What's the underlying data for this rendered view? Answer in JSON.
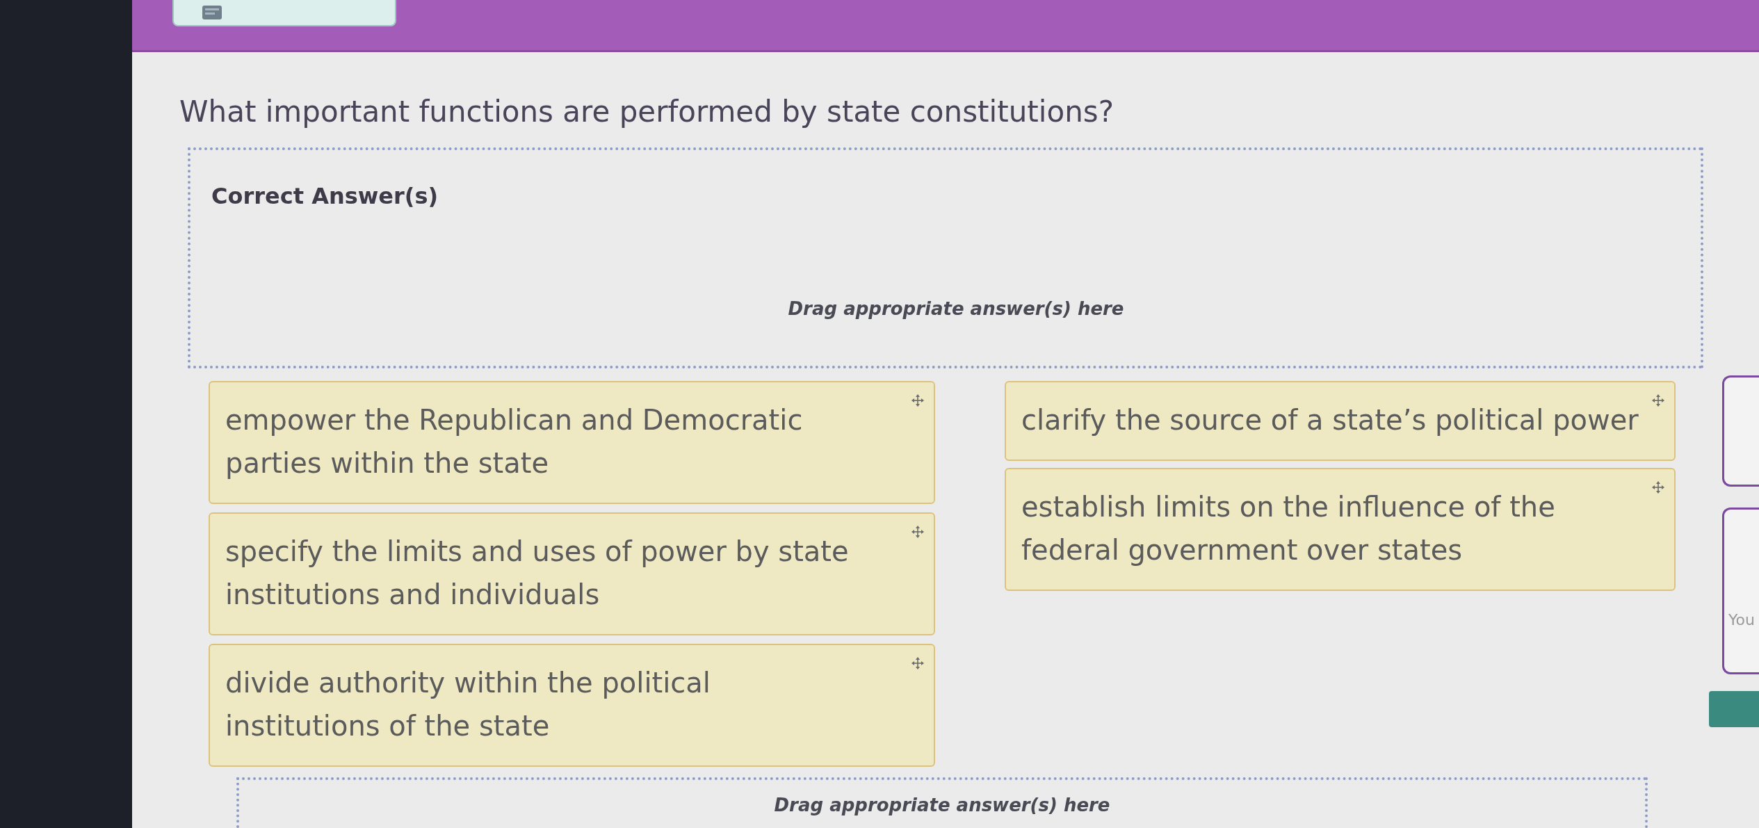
{
  "question": "What important functions are performed by state constitutions?",
  "answer_zone": {
    "title": "Correct Answer(s)",
    "hint": "Drag appropriate answer(s) here"
  },
  "answer_columns": [
    {
      "options": [
        "empower the Republican and Democratic parties within the state",
        "specify the limits and uses of power by state institutions and individuals",
        "divide authority within the political institutions of the state"
      ]
    },
    {
      "options": [
        "clarify the source of a state’s political power",
        "establish limits on the influence of the federal government over states"
      ]
    }
  ],
  "lower_zone": {
    "hint": "Drag appropriate answer(s) here"
  },
  "side_panel": {
    "text": "You"
  }
}
